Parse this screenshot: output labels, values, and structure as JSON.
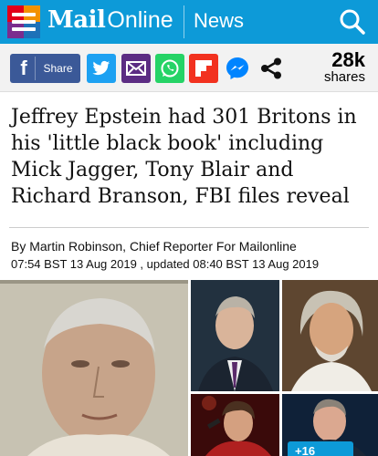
{
  "header": {
    "logo_mail": "Mail",
    "logo_online": "Online",
    "section": "News",
    "brand_color": "#0d9ad8"
  },
  "share": {
    "facebook_label": "Share",
    "count": "28k",
    "count_label": "shares",
    "icons": [
      "facebook-icon",
      "twitter-icon",
      "email-icon",
      "whatsapp-icon",
      "flipboard-icon",
      "messenger-icon",
      "share-icon"
    ]
  },
  "article": {
    "headline": "Jeffrey Epstein had 301 Britons in his 'little black book' including Mick Jagger, Tony Blair and Richard Branson, FBI files reveal",
    "byline": "By Martin Robinson, Chief Reporter For Mailonline",
    "dates": "07:54 BST 13 Aug 2019 , updated 08:40 BST 13 Aug 2019"
  },
  "gallery": {
    "badge": "+16"
  }
}
